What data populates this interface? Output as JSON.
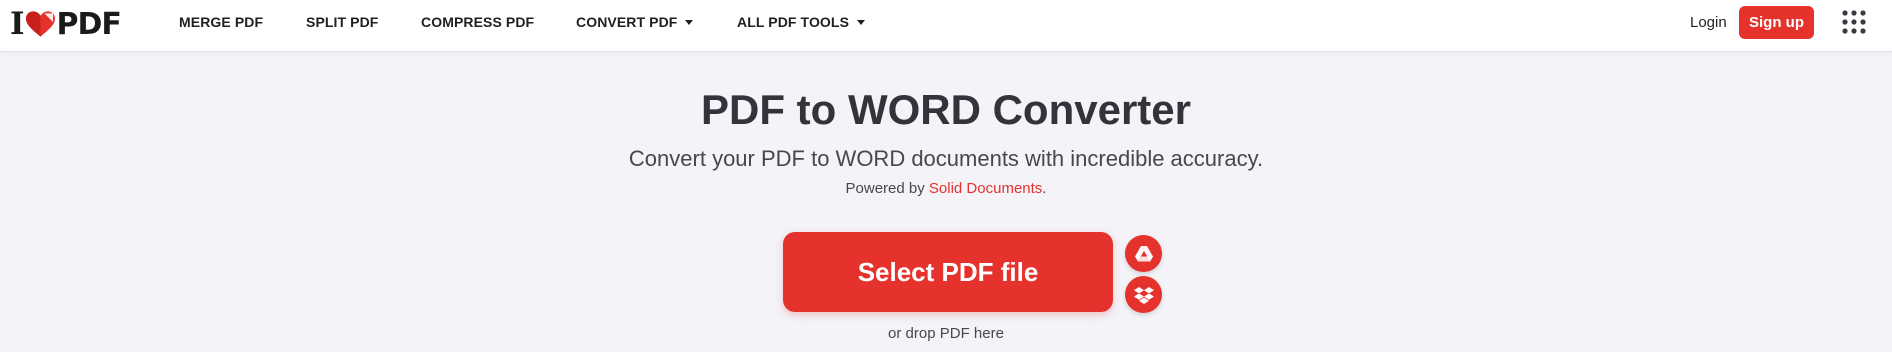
{
  "brand": {
    "logo_left": "I",
    "logo_right": "PDF",
    "accent": "#e5322d"
  },
  "nav": {
    "items": [
      {
        "label": "MERGE PDF"
      },
      {
        "label": "SPLIT PDF"
      },
      {
        "label": "COMPRESS PDF"
      },
      {
        "label": "CONVERT PDF"
      },
      {
        "label": "ALL PDF TOOLS"
      }
    ],
    "login_label": "Login",
    "signup_label": "Sign up"
  },
  "hero": {
    "title": "PDF to WORD Converter",
    "subtitle": "Convert your PDF to WORD documents with incredible accuracy.",
    "powered_prefix": "Powered by ",
    "powered_link": "Solid Documents",
    "powered_suffix": ".",
    "select_label": "Select PDF file",
    "drop_hint": "or drop PDF here"
  },
  "icons": {
    "logo": "heart-icon",
    "dropdown": "caret-down-icon",
    "apps": "apps-grid-icon",
    "google_drive": "google-drive-icon",
    "dropbox": "dropbox-icon"
  }
}
